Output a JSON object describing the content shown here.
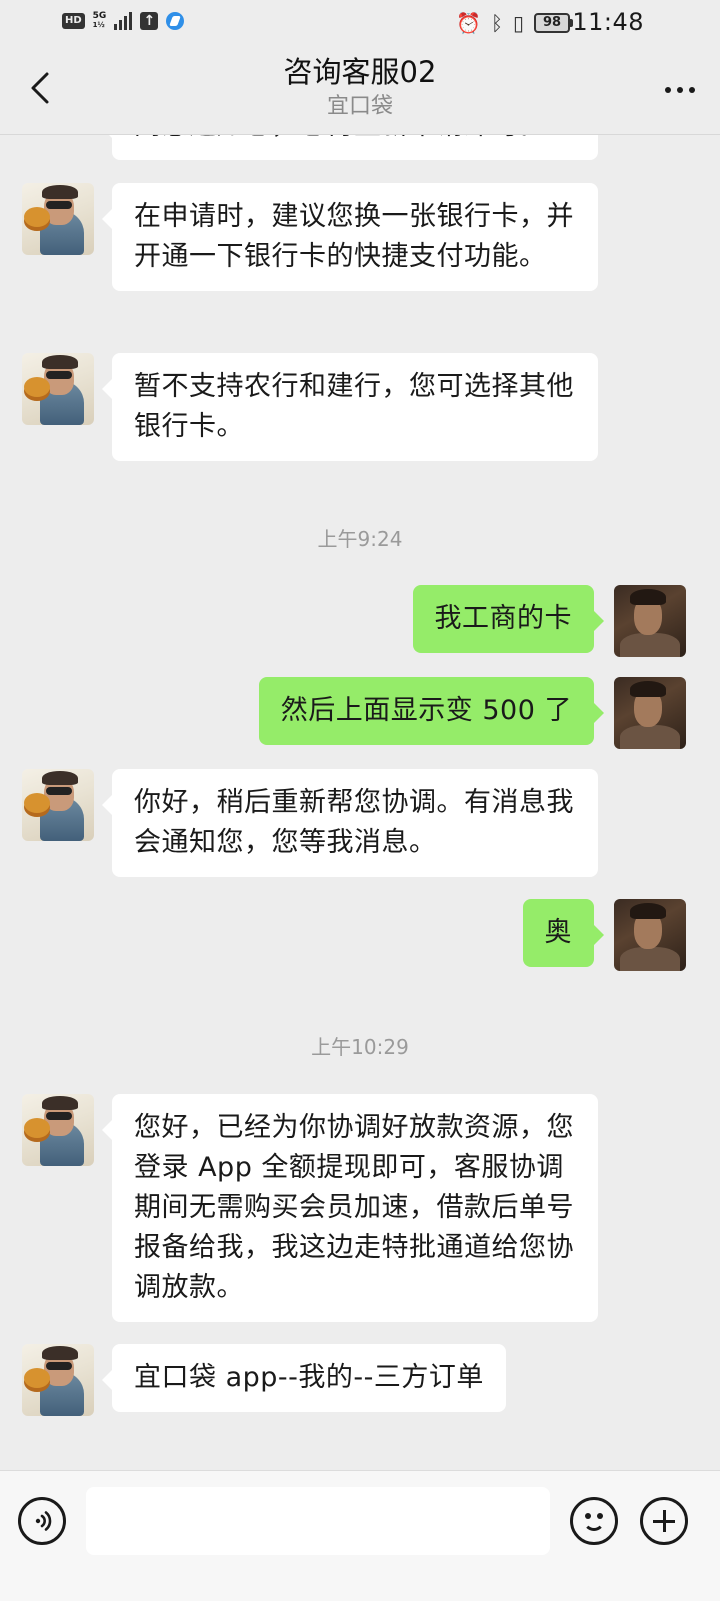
{
  "status_bar": {
    "hd": "HD",
    "network_top": "5G",
    "network_bottom": "1½",
    "battery": "98",
    "time": "11:48",
    "icons": [
      "alarm-icon",
      "bluetooth-icon",
      "vibrate-icon"
    ]
  },
  "header": {
    "title": "咨询客服02",
    "subtitle": "宜口袋"
  },
  "messages": [
    {
      "from": "agent",
      "text": "同意通知您，您再重新申请即可。"
    },
    {
      "from": "agent",
      "text": "在申请时，建议您换一张银行卡，并开通一下银行卡的快捷支付功能。"
    },
    {
      "from": "agent",
      "text": "暂不支持农行和建行，您可选择其他银行卡。"
    },
    {
      "type": "time",
      "text": "上午9:24"
    },
    {
      "from": "me",
      "text": "我工商的卡"
    },
    {
      "from": "me",
      "text": "然后上面显示变 500 了"
    },
    {
      "from": "agent",
      "text": "你好，稍后重新帮您协调。有消息我会通知您，您等我消息。"
    },
    {
      "from": "me",
      "text": "奥"
    },
    {
      "type": "time",
      "text": "上午10:29"
    },
    {
      "from": "agent",
      "text": "您好，已经为你协调好放款资源，您登录 App 全额提现即可，客服协调期间无需购买会员加速，借款后单号报备给我，我这边走特批通道给您协调放款。"
    },
    {
      "from": "agent",
      "text": "宜口袋 app--我的--三方订单"
    }
  ],
  "input_bar": {
    "placeholder": ""
  },
  "colors": {
    "background": "#ededed",
    "outgoing_bubble": "#95ec69",
    "incoming_bubble": "#ffffff",
    "timestamp": "#9a9a9a"
  }
}
